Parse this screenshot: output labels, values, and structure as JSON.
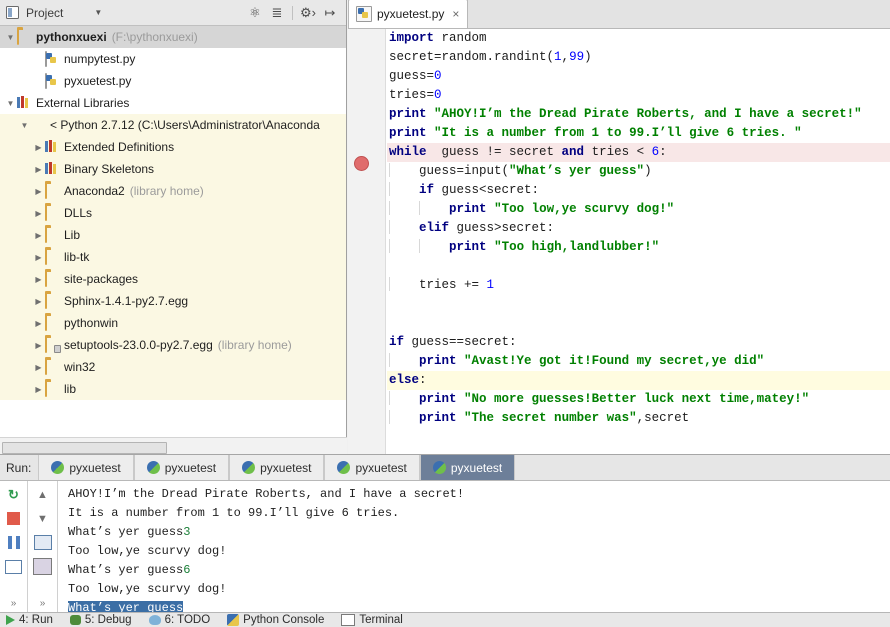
{
  "project_panel": {
    "title": "Project",
    "caret_icon": "chevron-down-icon",
    "tools": [
      {
        "name": "collapse-expand-icon",
        "glyph": "✹"
      },
      {
        "name": "flatten-packages-icon",
        "glyph": "≡"
      },
      {
        "name": "settings-gear-icon",
        "glyph": "⚙"
      },
      {
        "name": "hide-panel-icon",
        "glyph": "⇥"
      }
    ],
    "tree": [
      {
        "label": "pythonxuexi",
        "sub": "(F:\\pythonxuexi)",
        "icon": "folder-icon",
        "indent": 0,
        "arrow": "expanded",
        "bold": true,
        "selected": true,
        "cream": false
      },
      {
        "label": "numpytest.py",
        "sub": "",
        "icon": "python-file-icon",
        "indent": 2,
        "arrow": "none",
        "bold": false,
        "selected": false,
        "cream": false
      },
      {
        "label": "pyxuetest.py",
        "sub": "",
        "icon": "python-file-icon",
        "indent": 2,
        "arrow": "none",
        "bold": false,
        "selected": false,
        "cream": false
      },
      {
        "label": "External Libraries",
        "sub": "",
        "icon": "library-icon",
        "indent": 0,
        "arrow": "expanded",
        "bold": false,
        "selected": false,
        "cream": false
      },
      {
        "label": "< Python 2.7.12 (C:\\Users\\Administrator\\Anaconda",
        "sub": "",
        "icon": "python-sdk-icon",
        "indent": 1,
        "arrow": "expanded",
        "bold": false,
        "selected": false,
        "cream": true
      },
      {
        "label": "Extended Definitions",
        "sub": "",
        "icon": "library-icon",
        "indent": 2,
        "arrow": "collapsed",
        "bold": false,
        "selected": false,
        "cream": true
      },
      {
        "label": "Binary Skeletons",
        "sub": "",
        "icon": "library-icon",
        "indent": 2,
        "arrow": "collapsed",
        "bold": false,
        "selected": false,
        "cream": true
      },
      {
        "label": "Anaconda2",
        "sub": "(library home)",
        "icon": "folder-icon",
        "indent": 2,
        "arrow": "collapsed",
        "bold": false,
        "selected": false,
        "cream": true
      },
      {
        "label": "DLLs",
        "sub": "",
        "icon": "folder-icon",
        "indent": 2,
        "arrow": "collapsed",
        "bold": false,
        "selected": false,
        "cream": true
      },
      {
        "label": "Lib",
        "sub": "",
        "icon": "folder-icon",
        "indent": 2,
        "arrow": "collapsed",
        "bold": false,
        "selected": false,
        "cream": true
      },
      {
        "label": "lib-tk",
        "sub": "",
        "icon": "folder-icon",
        "indent": 2,
        "arrow": "collapsed",
        "bold": false,
        "selected": false,
        "cream": true
      },
      {
        "label": "site-packages",
        "sub": "",
        "icon": "folder-icon",
        "indent": 2,
        "arrow": "collapsed",
        "bold": false,
        "selected": false,
        "cream": true
      },
      {
        "label": "Sphinx-1.4.1-py2.7.egg",
        "sub": "",
        "icon": "folder-icon",
        "indent": 2,
        "arrow": "collapsed",
        "bold": false,
        "selected": false,
        "cream": true
      },
      {
        "label": "pythonwin",
        "sub": "",
        "icon": "folder-icon",
        "indent": 2,
        "arrow": "collapsed",
        "bold": false,
        "selected": false,
        "cream": true
      },
      {
        "label": "setuptools-23.0.0-py2.7.egg",
        "sub": "(library home)",
        "icon": "folder-locked-icon",
        "indent": 2,
        "arrow": "collapsed",
        "bold": false,
        "selected": false,
        "cream": true
      },
      {
        "label": "win32",
        "sub": "",
        "icon": "folder-icon",
        "indent": 2,
        "arrow": "collapsed",
        "bold": false,
        "selected": false,
        "cream": true
      },
      {
        "label": "lib",
        "sub": "",
        "icon": "folder-icon",
        "indent": 2,
        "arrow": "collapsed",
        "bold": false,
        "selected": false,
        "cream": true
      }
    ]
  },
  "editor": {
    "tab": {
      "label": "pyxuetest.py",
      "icon": "python-file-icon",
      "close_glyph": "×"
    },
    "breakpoint_line": 6,
    "lines": [
      {
        "indent": 0,
        "highlight": "none",
        "tokens": [
          {
            "t": "import",
            "c": "kw"
          },
          {
            "t": " random",
            "c": "pl"
          }
        ]
      },
      {
        "indent": 0,
        "highlight": "none",
        "tokens": [
          {
            "t": "secret=random.randint(",
            "c": "pl"
          },
          {
            "t": "1",
            "c": "nm"
          },
          {
            "t": ",",
            "c": "pl"
          },
          {
            "t": "99",
            "c": "nm"
          },
          {
            "t": ")",
            "c": "pl"
          }
        ]
      },
      {
        "indent": 0,
        "highlight": "none",
        "tokens": [
          {
            "t": "guess=",
            "c": "pl"
          },
          {
            "t": "0",
            "c": "nm"
          }
        ]
      },
      {
        "indent": 0,
        "highlight": "none",
        "tokens": [
          {
            "t": "tries=",
            "c": "pl"
          },
          {
            "t": "0",
            "c": "nm"
          }
        ]
      },
      {
        "indent": 0,
        "highlight": "none",
        "tokens": [
          {
            "t": "print",
            "c": "kw"
          },
          {
            "t": " ",
            "c": "pl"
          },
          {
            "t": "\"AHOY!I’m the Dread Pirate Roberts, and I have a secret!\"",
            "c": "st"
          }
        ]
      },
      {
        "indent": 0,
        "highlight": "none",
        "tokens": [
          {
            "t": "print",
            "c": "kw"
          },
          {
            "t": " ",
            "c": "pl"
          },
          {
            "t": "\"It is a number from 1 to 99.I’ll give 6 tries. \"",
            "c": "st"
          }
        ]
      },
      {
        "indent": 0,
        "highlight": "pink",
        "tokens": [
          {
            "t": "while",
            "c": "kw"
          },
          {
            "t": "  guess != secret ",
            "c": "pl"
          },
          {
            "t": "and",
            "c": "kw"
          },
          {
            "t": " tries < ",
            "c": "pl"
          },
          {
            "t": "6",
            "c": "nm"
          },
          {
            "t": ":",
            "c": "pl"
          }
        ]
      },
      {
        "indent": 1,
        "highlight": "none",
        "tokens": [
          {
            "t": "guess=input(",
            "c": "pl"
          },
          {
            "t": "\"What’s yer guess\"",
            "c": "st"
          },
          {
            "t": ")",
            "c": "pl"
          }
        ]
      },
      {
        "indent": 1,
        "highlight": "none",
        "tokens": [
          {
            "t": "if",
            "c": "kw"
          },
          {
            "t": " guess<secret:",
            "c": "pl"
          }
        ]
      },
      {
        "indent": 2,
        "highlight": "none",
        "tokens": [
          {
            "t": "print",
            "c": "kw"
          },
          {
            "t": " ",
            "c": "pl"
          },
          {
            "t": "\"Too low,ye scurvy dog!\"",
            "c": "st"
          }
        ]
      },
      {
        "indent": 1,
        "highlight": "none",
        "tokens": [
          {
            "t": "elif",
            "c": "kw"
          },
          {
            "t": " guess>secret:",
            "c": "pl"
          }
        ]
      },
      {
        "indent": 2,
        "highlight": "none",
        "tokens": [
          {
            "t": "print",
            "c": "kw"
          },
          {
            "t": " ",
            "c": "pl"
          },
          {
            "t": "\"Too high,landlubber!\"",
            "c": "st"
          }
        ]
      },
      {
        "indent": 0,
        "highlight": "none",
        "tokens": []
      },
      {
        "indent": 1,
        "highlight": "none",
        "tokens": [
          {
            "t": "tries += ",
            "c": "pl"
          },
          {
            "t": "1",
            "c": "nm"
          }
        ]
      },
      {
        "indent": 0,
        "highlight": "none",
        "tokens": []
      },
      {
        "indent": 0,
        "highlight": "none",
        "tokens": []
      },
      {
        "indent": 0,
        "highlight": "none",
        "tokens": [
          {
            "t": "if",
            "c": "kw"
          },
          {
            "t": " guess==secret:",
            "c": "pl"
          }
        ]
      },
      {
        "indent": 1,
        "highlight": "none",
        "tokens": [
          {
            "t": "print",
            "c": "kw"
          },
          {
            "t": " ",
            "c": "pl"
          },
          {
            "t": "\"Avast!Ye got it!Found my secret,ye did\"",
            "c": "st"
          }
        ]
      },
      {
        "indent": 0,
        "highlight": "yellow",
        "tokens": [
          {
            "t": "else",
            "c": "kw"
          },
          {
            "t": ":",
            "c": "pl"
          }
        ]
      },
      {
        "indent": 1,
        "highlight": "none",
        "tokens": [
          {
            "t": "print",
            "c": "kw"
          },
          {
            "t": " ",
            "c": "pl"
          },
          {
            "t": "\"No more guesses!Better luck next time,matey!\"",
            "c": "st"
          }
        ]
      },
      {
        "indent": 1,
        "highlight": "none",
        "tokens": [
          {
            "t": "print",
            "c": "kw"
          },
          {
            "t": " ",
            "c": "pl"
          },
          {
            "t": "\"The secret number was\"",
            "c": "st"
          },
          {
            "t": ",secret",
            "c": "pl"
          }
        ]
      }
    ]
  },
  "run_window": {
    "label": "Run:",
    "tabs": [
      {
        "label": "pyxuetest",
        "active": false
      },
      {
        "label": "pyxuetest",
        "active": false
      },
      {
        "label": "pyxuetest",
        "active": false
      },
      {
        "label": "pyxuetest",
        "active": false
      },
      {
        "label": "pyxuetest",
        "active": true
      }
    ],
    "toolbar_left": [
      {
        "name": "rerun-icon"
      },
      {
        "name": "stop-icon"
      },
      {
        "name": "pause-icon"
      },
      {
        "name": "print-icon"
      },
      {
        "name": "expand-more-icon"
      }
    ],
    "toolbar_right": [
      {
        "name": "scroll-up-icon"
      },
      {
        "name": "scroll-down-icon"
      },
      {
        "name": "soft-wrap-icon"
      },
      {
        "name": "scroll-to-end-icon"
      },
      {
        "name": "expand-more-icon"
      }
    ],
    "console": [
      {
        "text": "AHOY!I’m the Dread Pirate Roberts, and I have a secret!",
        "input": "",
        "selected": false
      },
      {
        "text": "It is a number from 1 to 99.I’ll give 6 tries.",
        "input": "",
        "selected": false
      },
      {
        "text": "What’s yer guess",
        "input": "3",
        "selected": false
      },
      {
        "text": "Too low,ye scurvy dog!",
        "input": "",
        "selected": false
      },
      {
        "text": "What’s yer guess",
        "input": "6",
        "selected": false
      },
      {
        "text": "Too low,ye scurvy dog!",
        "input": "",
        "selected": false
      },
      {
        "text": "What’s yer guess",
        "input": "",
        "selected": true
      }
    ]
  },
  "status_bar": {
    "items": [
      {
        "label": "4: Run",
        "icon": "run-icon"
      },
      {
        "label": "5: Debug",
        "icon": "debug-icon"
      },
      {
        "label": "6: TODO",
        "icon": "todo-icon"
      },
      {
        "label": "Python Console",
        "icon": "python-console-icon"
      },
      {
        "label": "Terminal",
        "icon": "terminal-icon"
      }
    ]
  },
  "colors": {
    "keyword": "#000080",
    "string": "#008000",
    "number": "#0000ff",
    "breakpoint": "#e06c6c",
    "exec_line_pink": "#f8e7e7",
    "caret_line_yellow": "#fffce0",
    "selection_blue": "#3b6ea5",
    "tree_cream": "#fbf8e3",
    "active_tab": "#6d7f99"
  }
}
